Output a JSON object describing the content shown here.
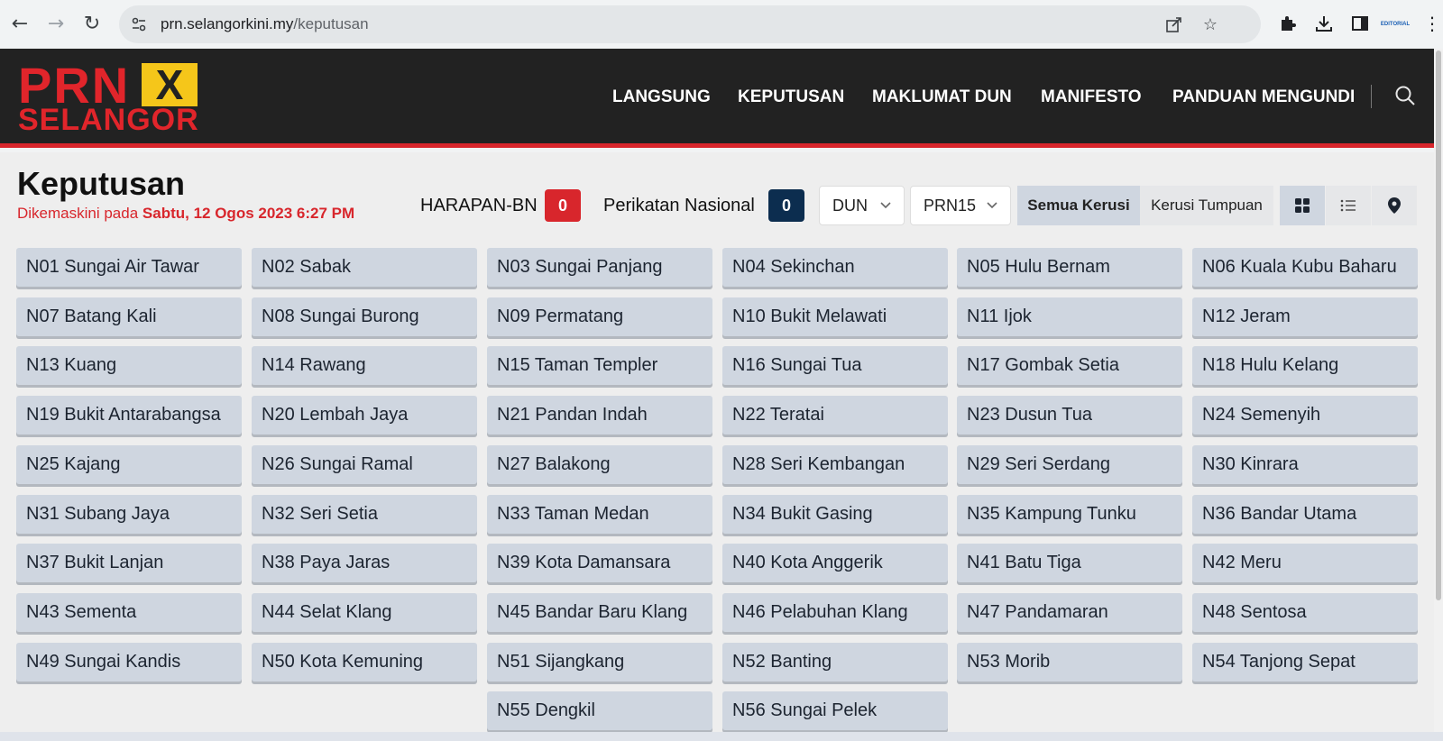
{
  "browser": {
    "url_host": "prn.selangorkini.my",
    "url_path": "/keputusan",
    "profile_label": "EDITORIAL"
  },
  "site": {
    "logo_top": "PRN",
    "logo_x": "X",
    "logo_bottom": "SELANGOR",
    "nav": [
      "LANGSUNG",
      "KEPUTUSAN",
      "MAKLUMAT DUN",
      "MANIFESTO",
      "PANDUAN MENGUNDI"
    ]
  },
  "page": {
    "title": "Keputusan",
    "updated_prefix": "Dikemaskini pada ",
    "updated_value": "Sabtu, 12 Ogos 2023 6:27 PM"
  },
  "scoreboard": {
    "party1_name": "HARAPAN-BN",
    "party1_seats": "0",
    "party1_color": "#d8262c",
    "party2_name": "Perikatan Nasional",
    "party2_seats": "0",
    "party2_color": "#0c2d4f"
  },
  "filters": {
    "type_select": "DUN",
    "election_select": "PRN15",
    "seg_all": "Semua Kerusi",
    "seg_focus": "Kerusi Tumpuan"
  },
  "seats": [
    "N01 Sungai Air Tawar",
    "N02 Sabak",
    "N03 Sungai Panjang",
    "N04 Sekinchan",
    "N05 Hulu Bernam",
    "N06 Kuala Kubu Baharu",
    "N07 Batang Kali",
    "N08 Sungai Burong",
    "N09 Permatang",
    "N10 Bukit Melawati",
    "N11 Ijok",
    "N12 Jeram",
    "N13 Kuang",
    "N14 Rawang",
    "N15 Taman Templer",
    "N16 Sungai Tua",
    "N17 Gombak Setia",
    "N18 Hulu Kelang",
    "N19 Bukit Antarabangsa",
    "N20 Lembah Jaya",
    "N21 Pandan Indah",
    "N22 Teratai",
    "N23 Dusun Tua",
    "N24 Semenyih",
    "N25 Kajang",
    "N26 Sungai Ramal",
    "N27 Balakong",
    "N28 Seri Kembangan",
    "N29 Seri Serdang",
    "N30 Kinrara",
    "N31 Subang Jaya",
    "N32 Seri Setia",
    "N33 Taman Medan",
    "N34 Bukit Gasing",
    "N35 Kampung Tunku",
    "N36 Bandar Utama",
    "N37 Bukit Lanjan",
    "N38 Paya Jaras",
    "N39 Kota Damansara",
    "N40 Kota Anggerik",
    "N41 Batu Tiga",
    "N42 Meru",
    "N43 Sementa",
    "N44 Selat Klang",
    "N45 Bandar Baru Klang",
    "N46 Pelabuhan Klang",
    "N47 Pandamaran",
    "N48 Sentosa",
    "N49 Sungai Kandis",
    "N50 Kota Kemuning",
    "N51 Sijangkang",
    "N52 Banting",
    "N53 Morib",
    "N54 Tanjong Sepat",
    "N55 Dengkil",
    "N56 Sungai Pelek"
  ]
}
